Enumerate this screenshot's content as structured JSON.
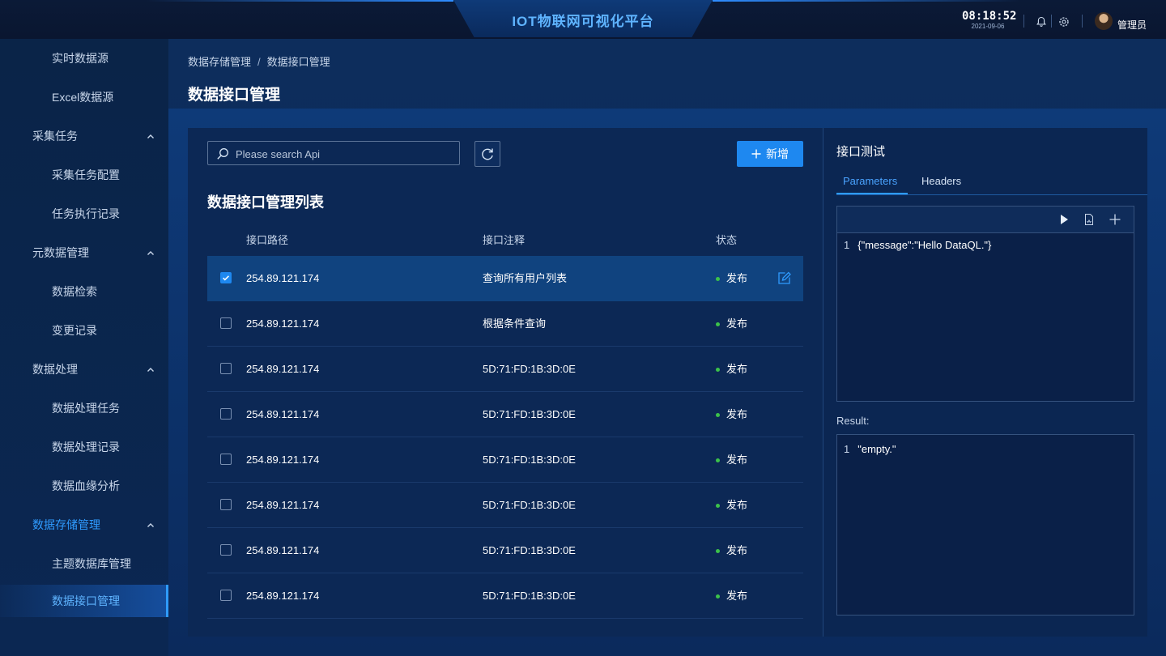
{
  "header": {
    "title": "IOT物联网可视化平台",
    "time": "08:18:52",
    "date": "2021-09-06",
    "user_name": "管理员"
  },
  "sidebar": {
    "items": [
      {
        "label": "实时数据源",
        "level": "sub"
      },
      {
        "label": "Excel数据源",
        "level": "sub"
      },
      {
        "label": "采集任务",
        "level": "group",
        "expanded": true
      },
      {
        "label": "采集任务配置",
        "level": "sub"
      },
      {
        "label": "任务执行记录",
        "level": "sub"
      },
      {
        "label": "元数据管理",
        "level": "group",
        "expanded": true
      },
      {
        "label": "数据检索",
        "level": "sub"
      },
      {
        "label": "变更记录",
        "level": "sub"
      },
      {
        "label": "数据处理",
        "level": "group",
        "expanded": true
      },
      {
        "label": "数据处理任务",
        "level": "sub"
      },
      {
        "label": "数据处理记录",
        "level": "sub"
      },
      {
        "label": "数据血缘分析",
        "level": "sub"
      },
      {
        "label": "数据存储管理",
        "level": "group",
        "expanded": true,
        "active": true
      },
      {
        "label": "主题数据库管理",
        "level": "sub"
      },
      {
        "label": "数据接口管理",
        "level": "sub",
        "active": true
      }
    ]
  },
  "breadcrumb": {
    "parent": "数据存储管理",
    "separator": "/",
    "current": "数据接口管理"
  },
  "page_title": "数据接口管理",
  "search": {
    "placeholder": "Please search Api",
    "value": ""
  },
  "add_button_label": "新增",
  "list": {
    "title": "数据接口管理列表",
    "columns": [
      "接口路径",
      "接口注释",
      "状态"
    ],
    "rows": [
      {
        "path": "254.89.121.174",
        "comment": "查询所有用户列表",
        "status": "发布",
        "checked": true
      },
      {
        "path": "254.89.121.174",
        "comment": "根据条件查询",
        "status": "发布",
        "checked": false
      },
      {
        "path": "254.89.121.174",
        "comment": "5D:71:FD:1B:3D:0E",
        "status": "发布",
        "checked": false
      },
      {
        "path": "254.89.121.174",
        "comment": "5D:71:FD:1B:3D:0E",
        "status": "发布",
        "checked": false
      },
      {
        "path": "254.89.121.174",
        "comment": "5D:71:FD:1B:3D:0E",
        "status": "发布",
        "checked": false
      },
      {
        "path": "254.89.121.174",
        "comment": "5D:71:FD:1B:3D:0E",
        "status": "发布",
        "checked": false
      },
      {
        "path": "254.89.121.174",
        "comment": "5D:71:FD:1B:3D:0E",
        "status": "发布",
        "checked": false
      },
      {
        "path": "254.89.121.174",
        "comment": "5D:71:FD:1B:3D:0E",
        "status": "发布",
        "checked": false
      }
    ]
  },
  "test_panel": {
    "title": "接口测试",
    "tabs": [
      "Parameters",
      "Headers"
    ],
    "active_tab": "Parameters",
    "params_line_no": "1",
    "params_code": "{\"message\":\"Hello DataQL.\"}",
    "result_label": "Result:",
    "result_line_no": "1",
    "result_code": "\"empty.\""
  },
  "colors": {
    "accent": "#1e88f0",
    "status_published": "#3cc24a",
    "title": "#5fb4ff"
  },
  "icons": [
    "bell-icon",
    "gear-icon",
    "search-icon",
    "refresh-icon",
    "plus-icon",
    "edit-icon",
    "play-icon",
    "file-icon",
    "chevron-up-icon"
  ]
}
